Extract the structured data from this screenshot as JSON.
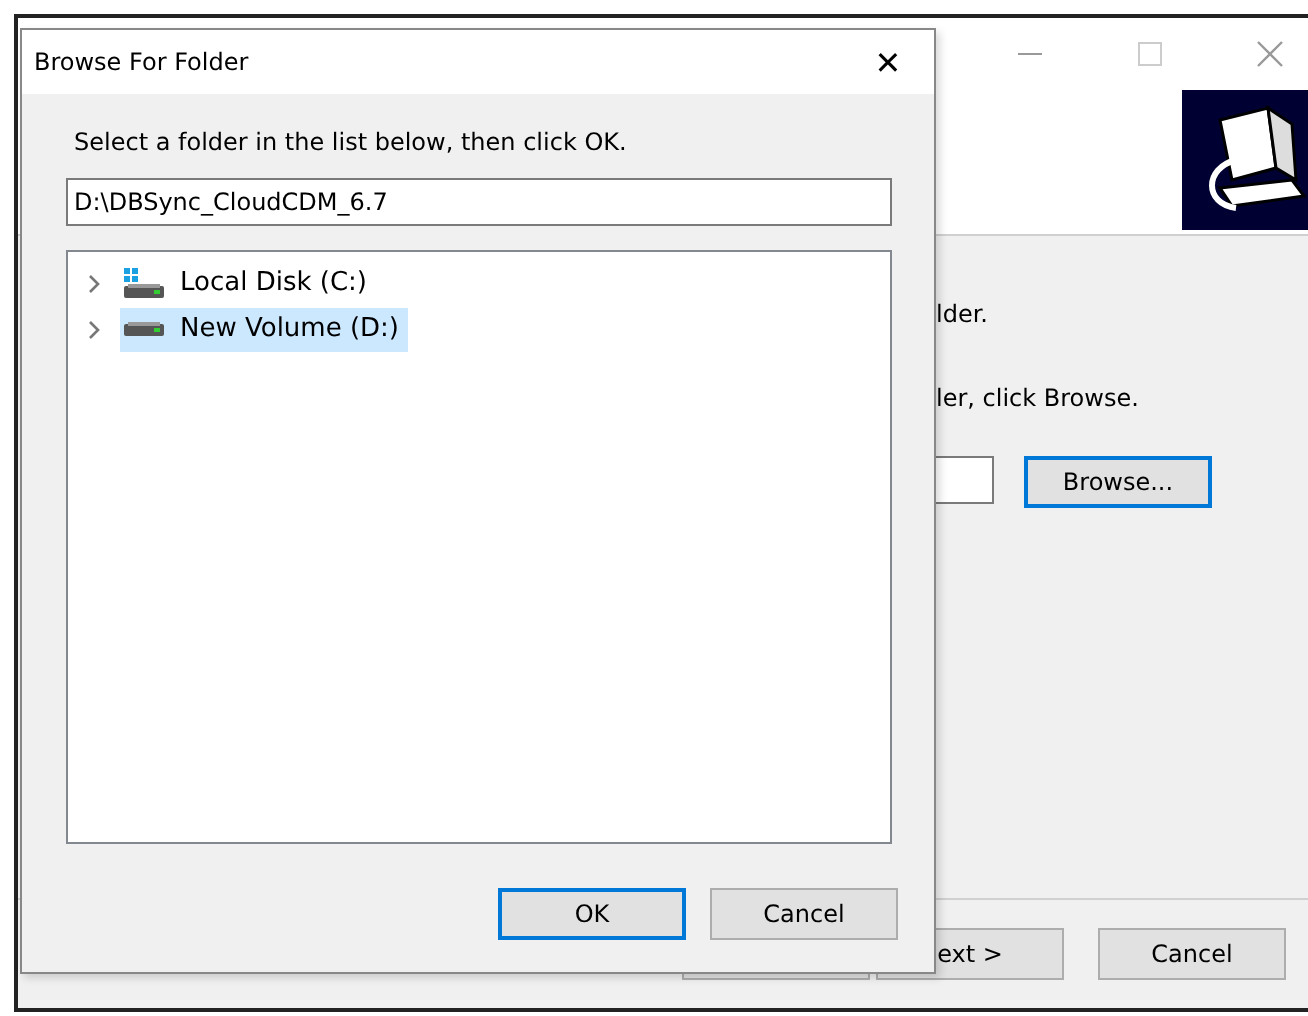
{
  "installer": {
    "body_lines": [
      "lder.",
      "ler, click Browse."
    ],
    "browse_button": "Browse...",
    "buttons": [
      {
        "focused": false
      },
      {
        "label": "ext >",
        "focused": false
      },
      {
        "label": "Cancel",
        "focused": false
      }
    ]
  },
  "dialog": {
    "title": "Browse For Folder",
    "close": "✕",
    "instruction": "Select a folder in the list below, then click OK.",
    "path": "D:\\DBSync_CloudCDM_6.7",
    "tree": [
      {
        "label": "Local Disk (C:)",
        "kind": "system",
        "selected": false,
        "expanded": false
      },
      {
        "label": "New Volume (D:)",
        "kind": "drive",
        "selected": true,
        "expanded": false
      }
    ],
    "buttons": [
      {
        "label": "OK",
        "focused": true
      },
      {
        "label": "Cancel",
        "focused": false
      }
    ]
  }
}
